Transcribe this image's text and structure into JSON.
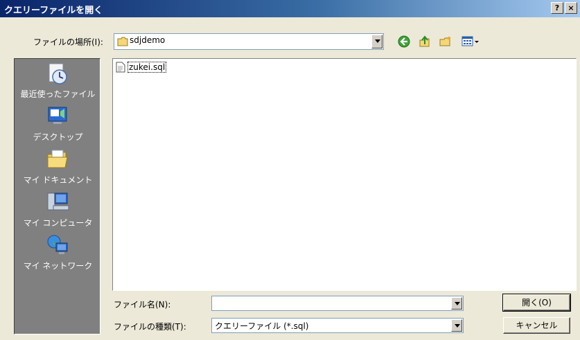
{
  "window": {
    "title": "クエリーファイルを開く",
    "help_button": "?",
    "close_button": "×"
  },
  "lookin": {
    "label": "ファイルの場所(I):",
    "value": "sdjdemo"
  },
  "toolbar": {
    "icons": [
      "back-icon",
      "up-folder-icon",
      "new-folder-icon",
      "view-menu-icon"
    ]
  },
  "places": [
    {
      "label": "最近使ったファイル",
      "icon": "recent-documents-icon"
    },
    {
      "label": "デスクトップ",
      "icon": "desktop-icon"
    },
    {
      "label": "マイ ドキュメント",
      "icon": "my-documents-icon"
    },
    {
      "label": "マイ コンピュータ",
      "icon": "my-computer-icon"
    },
    {
      "label": "マイ ネットワーク",
      "icon": "my-network-icon"
    }
  ],
  "files": [
    {
      "name": "zukei.sql",
      "icon": "text-file-icon"
    }
  ],
  "filename": {
    "label": "ファイル名(N):",
    "value": ""
  },
  "filetype": {
    "label": "ファイルの種類(T):",
    "value": "クエリーファイル (*.sql)"
  },
  "buttons": {
    "open": "開く(O)",
    "cancel": "キャンセル"
  },
  "colors": {
    "title_gradient_start": "#0a246a",
    "places_bar": "#808080",
    "dialog_face": "#ece9d8"
  }
}
